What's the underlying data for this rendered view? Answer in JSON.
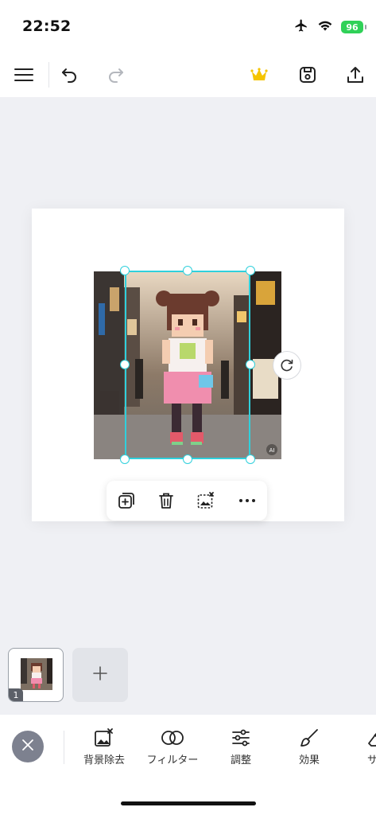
{
  "status_bar": {
    "time": "22:52",
    "battery": "96"
  },
  "toolbar": {
    "menu_icon": "hamburger-icon",
    "undo_icon": "undo-icon",
    "redo_icon": "redo-icon",
    "premium_icon": "crown-icon",
    "save_icon": "save-icon",
    "share_icon": "share-icon",
    "premium_color": "#f5c400"
  },
  "canvas": {
    "selection_color": "#2fd0dc",
    "image_badge": "AI"
  },
  "floating_toolbar": {
    "items": [
      "duplicate-icon",
      "delete-icon",
      "replace-image-icon",
      "more-icon"
    ]
  },
  "pages": {
    "thumbnails": [
      {
        "number": "1"
      }
    ],
    "add_label": "+"
  },
  "bottom_tools": {
    "items": [
      {
        "label": "背景除去",
        "icon": "remove-background-icon"
      },
      {
        "label": "フィルター",
        "icon": "filter-icon"
      },
      {
        "label": "調整",
        "icon": "adjust-icon"
      },
      {
        "label": "効果",
        "icon": "brush-icon"
      },
      {
        "label": "サイ",
        "icon": "eraser-icon"
      }
    ]
  }
}
